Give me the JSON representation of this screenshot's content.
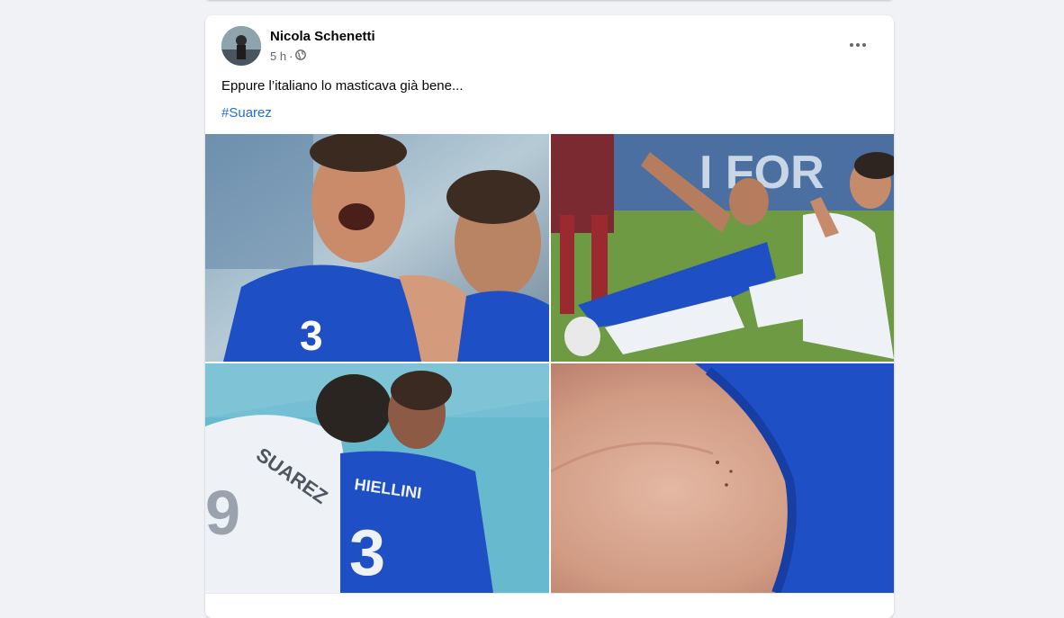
{
  "post": {
    "author": "Nicola Schenetti",
    "time": "5 h",
    "separator": "·",
    "privacy_icon": "globe-icon",
    "more_icon": "more-options-icon",
    "text": "Eppure l’italiano lo masticava già bene...",
    "hashtag": "#Suarez"
  },
  "photos": [
    {
      "name": "photo-1",
      "description_icon": "image"
    },
    {
      "name": "photo-2",
      "description_icon": "image",
      "banner_text": "I FOR"
    },
    {
      "name": "photo-3",
      "description_icon": "image",
      "jersey_back": "SUAREZ",
      "jersey_front": "HIELLINI",
      "number_left": "9",
      "number_right": "3"
    },
    {
      "name": "photo-4",
      "description_icon": "image"
    }
  ],
  "colors": {
    "link": "#216fdb",
    "text": "#050505",
    "secondary": "#65676b",
    "italy_blue": "#1f4fc4",
    "uruguay_white": "#eef1f6"
  }
}
